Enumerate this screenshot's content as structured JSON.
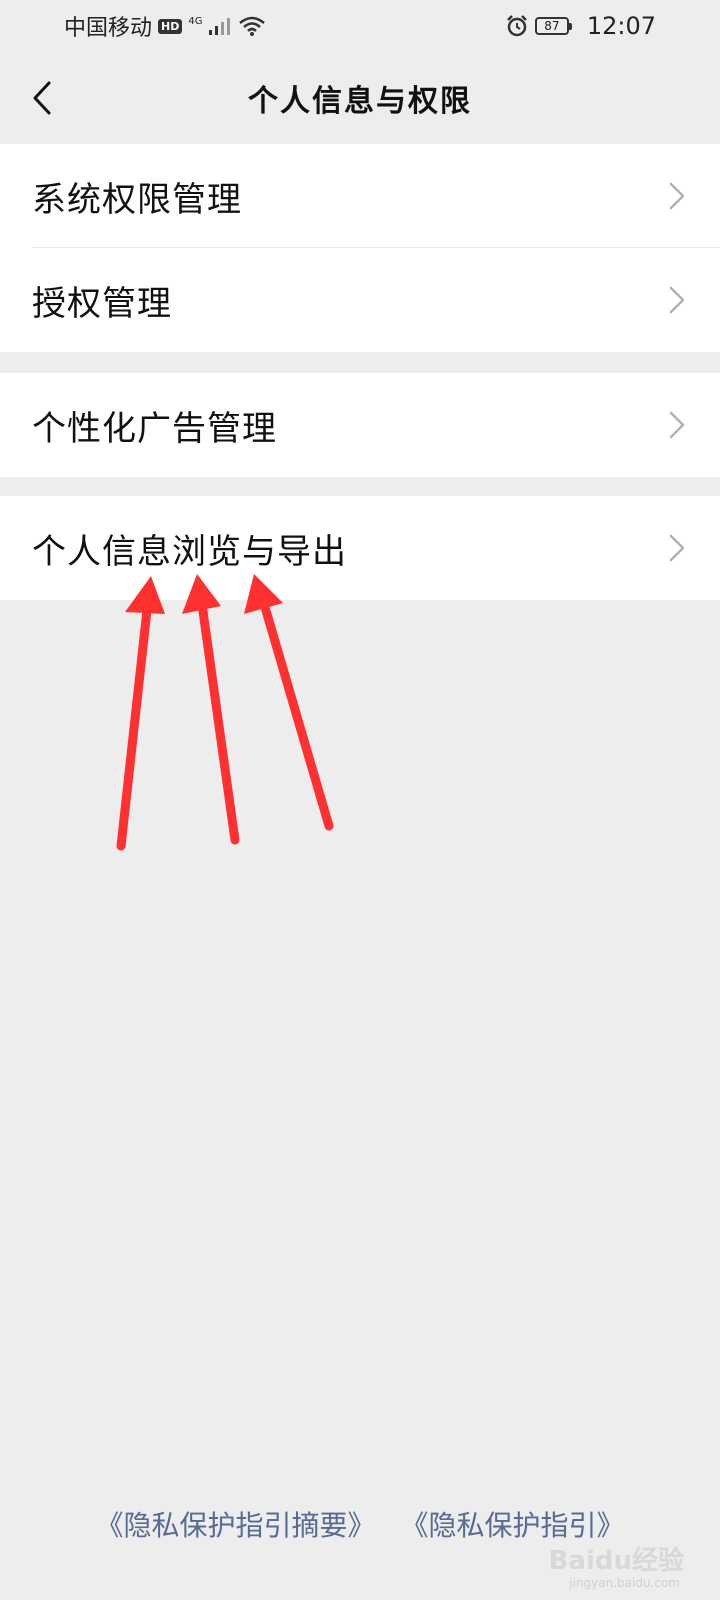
{
  "status_bar": {
    "carrier": "中国移动",
    "hd": "HD",
    "network": "4G",
    "battery": "87",
    "time": "12:07"
  },
  "nav": {
    "back_icon": "chevron-left-icon",
    "title": "个人信息与权限"
  },
  "groups": [
    {
      "items": [
        {
          "label": "系统权限管理"
        },
        {
          "label": "授权管理"
        }
      ]
    },
    {
      "items": [
        {
          "label": "个性化广告管理"
        }
      ]
    },
    {
      "items": [
        {
          "label": "个人信息浏览与导出"
        }
      ]
    }
  ],
  "footer": {
    "link1": "《隐私保护指引摘要》",
    "link2": "《隐私保护指引》"
  },
  "annotation": {
    "arrow_color": "#ff3030"
  },
  "watermark": {
    "text": "Baidu经验",
    "sub": "jingyan.baidu.com"
  }
}
